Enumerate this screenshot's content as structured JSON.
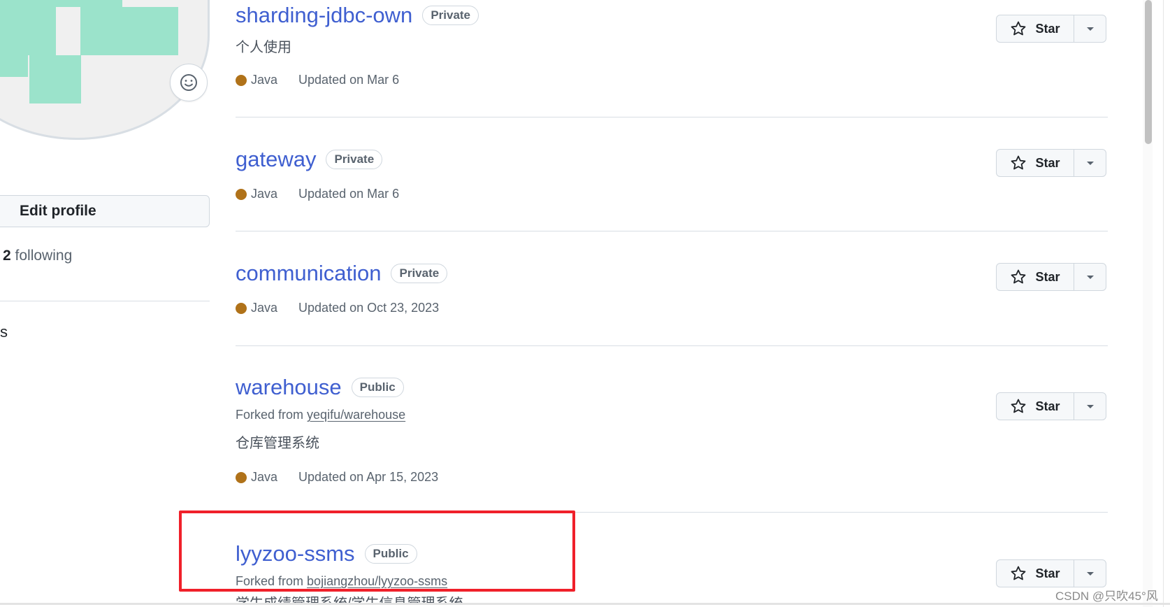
{
  "profile": {
    "edit_label": "Edit profile",
    "following_count": "2",
    "following_label": "following",
    "side_letter": "s"
  },
  "repos": [
    {
      "name": "sharding-jdbc-own",
      "visibility": "Private",
      "description": "个人使用",
      "language": "Java",
      "updated": "Updated on Mar 6"
    },
    {
      "name": "gateway",
      "visibility": "Private",
      "language": "Java",
      "updated": "Updated on Mar 6"
    },
    {
      "name": "communication",
      "visibility": "Private",
      "language": "Java",
      "updated": "Updated on Oct 23, 2023"
    },
    {
      "name": "warehouse",
      "visibility": "Public",
      "forked_prefix": "Forked from",
      "forked_source": "yeqifu/warehouse",
      "description": "仓库管理系统",
      "language": "Java",
      "updated": "Updated on Apr 15, 2023"
    },
    {
      "name": "lyyzoo-ssms",
      "visibility": "Public",
      "forked_prefix": "Forked from",
      "forked_source": "bojiangzhou/lyyzoo-ssms",
      "description": "学生成绩管理系统/学生信息管理系统"
    }
  ],
  "star_label": "Star",
  "language_color": "#b07219",
  "accent_color": "#3f5fd0",
  "highlight_color": "#f0202a",
  "watermark": "CSDN @只吹45°风"
}
